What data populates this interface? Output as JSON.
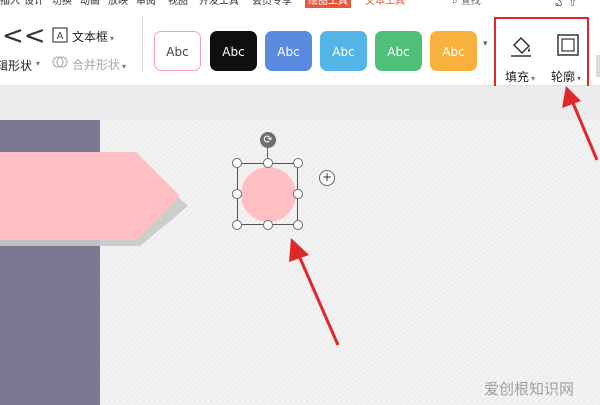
{
  "menubar": {
    "items": [
      "插入",
      "设计",
      "切换",
      "动画",
      "放映",
      "审阅",
      "视图",
      "开发工具",
      "会员专享",
      "绘图工具",
      "文本工具"
    ],
    "active_index": 9,
    "search": "查找"
  },
  "ribbon": {
    "edit_shape_label": "编辑形状",
    "text_box_label": "文本框",
    "merge_shape_label": "合并形状",
    "style_presets": [
      {
        "label": "Abc",
        "bg": "#ffffff",
        "fg": "#444444",
        "border": "#f2a4ac"
      },
      {
        "label": "Abc",
        "bg": "#0f0f0f",
        "fg": "#ffffff",
        "border": "#0f0f0f"
      },
      {
        "label": "Abc",
        "bg": "#5a8be0",
        "fg": "#ffffff",
        "border": "#5a8be0"
      },
      {
        "label": "Abc",
        "bg": "#52b5e5",
        "fg": "#ffffff",
        "border": "#52b5e5"
      },
      {
        "label": "Abc",
        "bg": "#4fbf7a",
        "fg": "#ffffff",
        "border": "#4fbf7a"
      },
      {
        "label": "Abc",
        "bg": "#f8b13c",
        "fg": "#ffffff",
        "border": "#f8b13c"
      }
    ],
    "fill_label": "填充",
    "outline_label": "轮廓"
  },
  "canvas": {
    "plus_symbol": "+",
    "rotate_symbol": "⟳"
  },
  "colors": {
    "accent": "#e8563b",
    "annotation_red": "#e02828",
    "panel_purple": "#7d7891",
    "shape_pink": "#ffc0c3",
    "arrow_shadow": "#c9c9c9"
  },
  "watermark": "爱创根知识网"
}
